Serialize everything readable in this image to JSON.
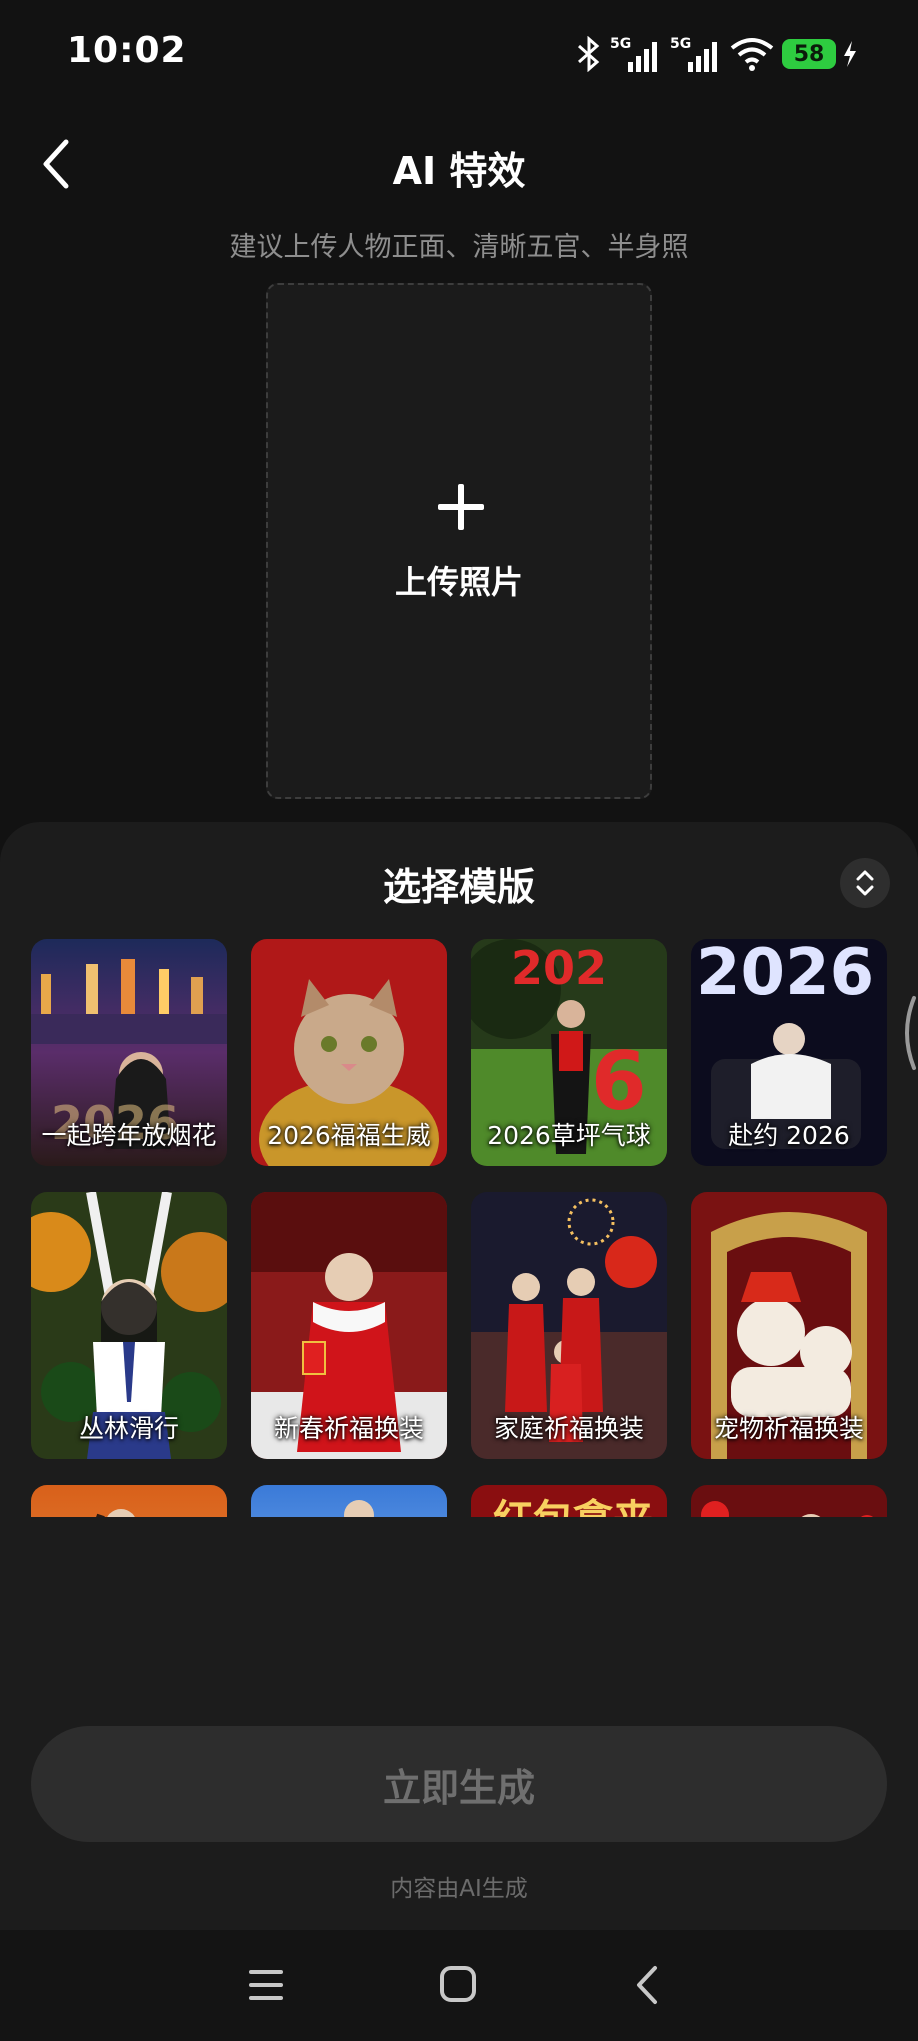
{
  "status": {
    "time": "10:02",
    "signal1": "5G",
    "signal2": "5G",
    "battery": "58"
  },
  "header": {
    "title": "AI 特效",
    "hint": "建议上传人物正面、清晰五官、半身照"
  },
  "upload": {
    "label": "上传照片"
  },
  "sheet": {
    "title": "选择模版"
  },
  "templates": [
    {
      "label": "一起跨年放烟花"
    },
    {
      "label": "2026福福生威"
    },
    {
      "label": "2026草坪气球"
    },
    {
      "label": "赴约 2026"
    },
    {
      "label": "丛林滑行"
    },
    {
      "label": "新春祈福换装"
    },
    {
      "label": "家庭祈福换装"
    },
    {
      "label": "宠物祈福换装"
    },
    {
      "label": ""
    },
    {
      "label": ""
    },
    {
      "label": ""
    },
    {
      "label": ""
    }
  ],
  "generate_button": {
    "label": "立即生成"
  },
  "ai_note": "内容由AI生成",
  "colors": {
    "background": "#121212",
    "sheet": "#1c1c1c",
    "button": "#2d2d2d",
    "battery": "#2ecc40"
  }
}
